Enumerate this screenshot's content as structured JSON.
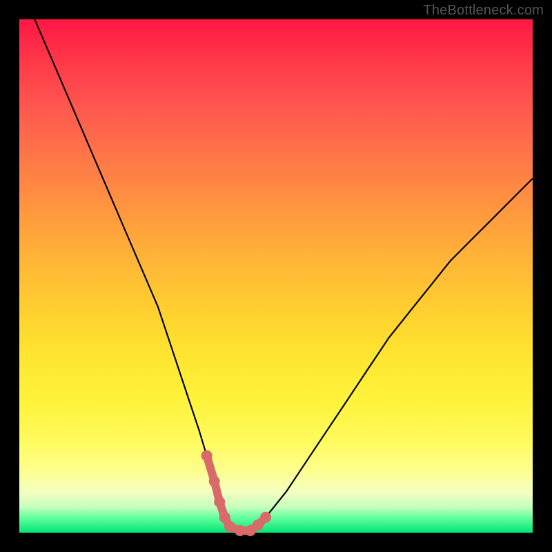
{
  "watermark": "TheBottleneck.com",
  "chart_data": {
    "type": "line",
    "title": "",
    "xlabel": "",
    "ylabel": "",
    "xlim": [
      0,
      100
    ],
    "ylim": [
      0,
      100
    ],
    "grid": false,
    "series": [
      {
        "name": "bottleneck-curve",
        "color": "#000000",
        "x": [
          3,
          6,
          9,
          12,
          15,
          18,
          21,
          24,
          27,
          29,
          31,
          33,
          35,
          36.5,
          38,
          39,
          40,
          41,
          43,
          45,
          46.5,
          48,
          52,
          56,
          60,
          64,
          68,
          72,
          76,
          80,
          84,
          88,
          92,
          96,
          100
        ],
        "y": [
          100,
          93,
          86,
          79,
          72,
          65,
          58,
          51,
          44,
          38,
          32,
          26,
          20,
          15,
          10,
          6,
          3,
          1.2,
          0.4,
          0.4,
          1.5,
          3,
          8,
          14,
          20,
          26,
          32,
          38,
          43,
          48,
          53,
          57,
          61,
          65,
          69
        ]
      },
      {
        "name": "bottleneck-markers",
        "color": "#d86a6a",
        "x": [
          36.5,
          38,
          39,
          40,
          41,
          43,
          45,
          46.5,
          48
        ],
        "y": [
          15,
          10,
          6,
          3,
          1.2,
          0.4,
          0.4,
          1.5,
          3
        ]
      }
    ],
    "note": "Axes are unlabeled; y values estimated from curve height relative to frame (0 = bottom, 100 = top)."
  },
  "colors": {
    "frame": "#000000",
    "curve": "#000000",
    "markers": "#d86a6a",
    "gradient_top": "#ff1744",
    "gradient_bottom": "#00e676"
  }
}
